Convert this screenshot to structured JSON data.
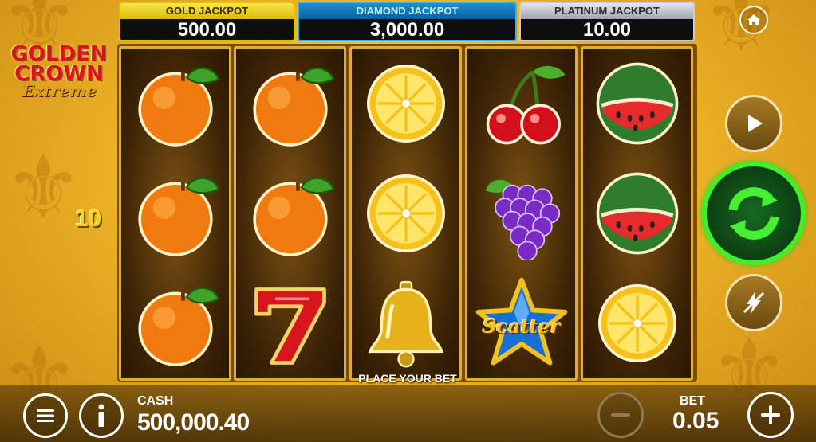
{
  "jackpots": {
    "gold": {
      "title": "GOLD JACKPOT",
      "value": "500.00"
    },
    "diamond": {
      "title": "DIAMOND JACKPOT",
      "value": "3,000.00"
    },
    "platinum": {
      "title": "PLATINUM JACKPOT",
      "value": "10.00"
    }
  },
  "logo": {
    "line1": "GOLDEN",
    "line2": "CROWN",
    "line3": "Extreme"
  },
  "lines_count": "10",
  "reels": [
    [
      "orange-icon",
      "orange-icon",
      "orange-icon"
    ],
    [
      "orange-icon",
      "orange-icon",
      "seven-icon"
    ],
    [
      "lemon-icon",
      "lemon-icon",
      "bell-icon"
    ],
    [
      "cherry-icon",
      "grapes-icon",
      "scatter-star-icon"
    ],
    [
      "watermelon-icon",
      "watermelon-icon",
      "lemon-icon"
    ]
  ],
  "scatter_label": "Scatter",
  "status_text": "PLACE YOUR BET",
  "cash": {
    "label": "CASH",
    "value": "500,000.40"
  },
  "bet": {
    "label": "BET",
    "value": "0.05"
  },
  "colors": {
    "spin_ring": "#3ef02a",
    "gold_border": "#e2c200",
    "diamond_border": "#35b4e8",
    "platinum_border": "#c9ccd2"
  }
}
